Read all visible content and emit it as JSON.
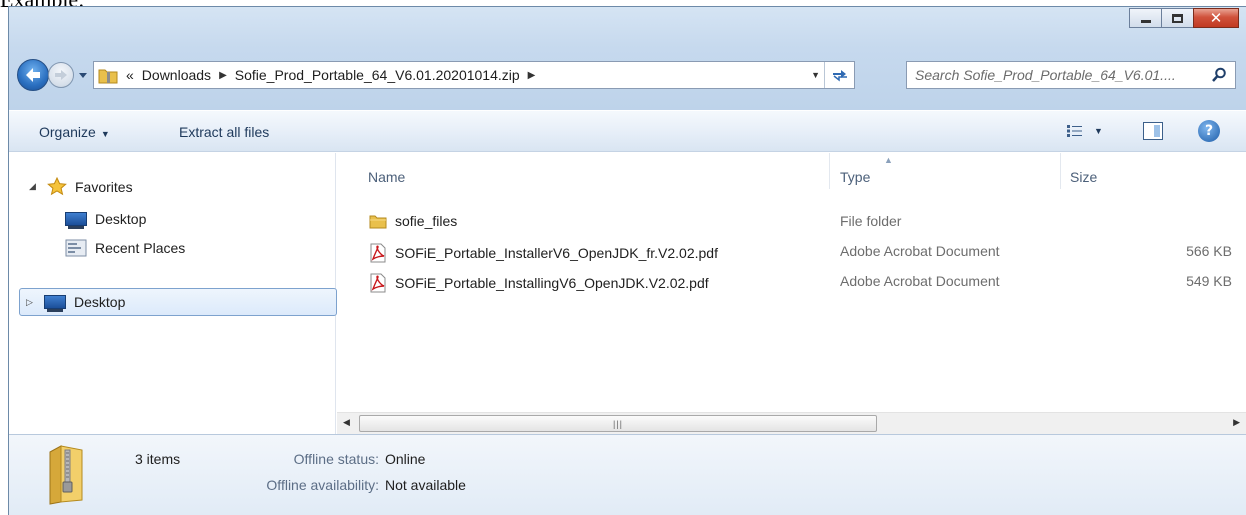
{
  "caption": "Example:",
  "nav": {
    "breadcrumb_prefix": "«",
    "crumbs": [
      "Downloads",
      "Sofie_Prod_Portable_64_V6.01.20201014.zip"
    ],
    "search_placeholder": "Search Sofie_Prod_Portable_64_V6.01...."
  },
  "toolbar": {
    "organize": "Organize",
    "extract": "Extract all files"
  },
  "sidebar": {
    "favorites": "Favorites",
    "items": [
      "Desktop",
      "Recent Places"
    ],
    "desktop_root": "Desktop"
  },
  "columns": {
    "name": "Name",
    "type": "Type",
    "size": "Size"
  },
  "files": [
    {
      "name": "sofie_files",
      "type": "File folder",
      "size": "",
      "icon": "folder-icon"
    },
    {
      "name": "SOFiE_Portable_InstallerV6_OpenJDK_fr.V2.02.pdf",
      "type": "Adobe Acrobat Document",
      "size": "566 KB",
      "icon": "pdf-icon"
    },
    {
      "name": "SOFiE_Portable_InstallingV6_OpenJDK.V2.02.pdf",
      "type": "Adobe Acrobat Document",
      "size": "549 KB",
      "icon": "pdf-icon"
    }
  ],
  "details": {
    "count": "3 items",
    "status_label": "Offline status:",
    "status_value": "Online",
    "availability_label": "Offline availability:",
    "availability_value": "Not available"
  },
  "colors": {
    "frame": "#c6d9ee",
    "close_button": "#c13a22",
    "selection": "#dceafb"
  }
}
